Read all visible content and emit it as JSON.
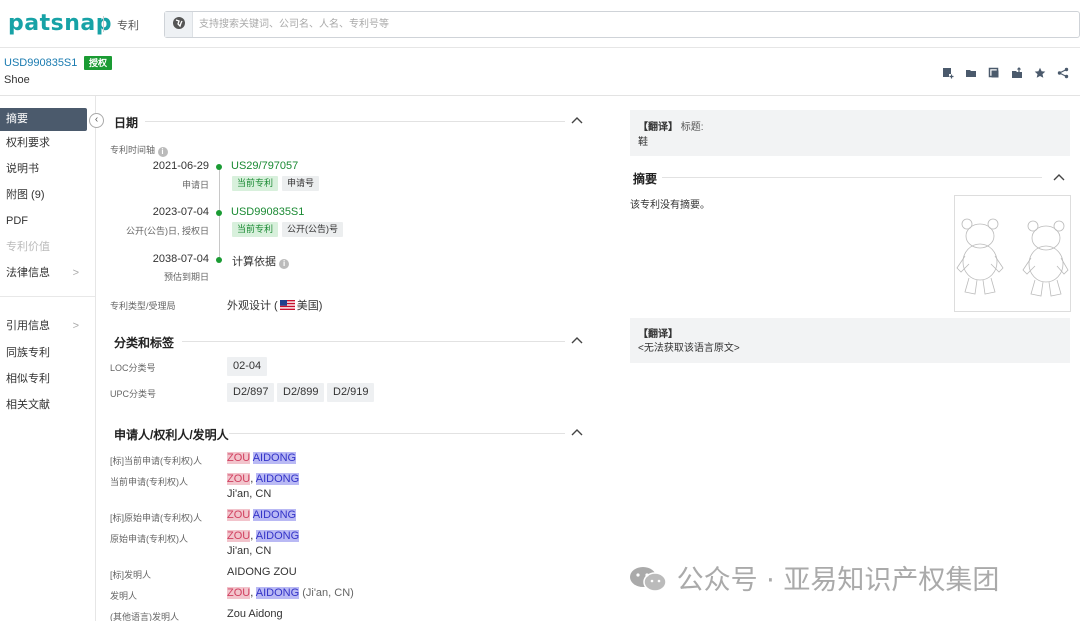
{
  "topbar": {
    "logo": "patsnap",
    "module": "专利",
    "search_placeholder": "支持搜索关键词、公司名、人名、专利号等"
  },
  "patent": {
    "number": "USD990835S1",
    "status_badge": "授权",
    "title": "Shoe"
  },
  "toolbar": [
    "add-note-icon",
    "folder-icon",
    "copy-icon",
    "export-icon",
    "star-icon",
    "share-icon"
  ],
  "sidebar": {
    "items": [
      {
        "label": "摘要"
      },
      {
        "label": "权利要求"
      },
      {
        "label": "说明书"
      },
      {
        "label": "附图 (9)"
      },
      {
        "label": "PDF"
      },
      {
        "label": "专利价值"
      },
      {
        "label": "法律信息"
      },
      {
        "label": "引用信息"
      },
      {
        "label": "同族专利"
      },
      {
        "label": "相似专利"
      },
      {
        "label": "相关文献"
      }
    ]
  },
  "dates": {
    "title": "日期",
    "timeline_label": "专利时间轴",
    "events": [
      {
        "date": "2021-06-29",
        "sub": "申请日",
        "number": "US29/797057",
        "tags": [
          "当前专利",
          "申请号"
        ]
      },
      {
        "date": "2023-07-04",
        "sub": "公开(公告)日, 授权日",
        "number": "USD990835S1",
        "tags": [
          "当前专利",
          "公开(公告)号"
        ]
      },
      {
        "date": "2038-07-04",
        "sub": "预估到期日",
        "number": "计算依据",
        "tags": []
      }
    ],
    "type_label": "专利类型/受理局",
    "type_value_pre": "外观设计 (",
    "type_value_post": "美国)"
  },
  "classification": {
    "title": "分类和标签",
    "loc_label": "LOC分类号",
    "loc_values": [
      "02-04"
    ],
    "upc_label": "UPC分类号",
    "upc_values": [
      "D2/897",
      "D2/899",
      "D2/919"
    ]
  },
  "parties": {
    "title": "申请人/权利人/发明人",
    "rows": [
      {
        "label": "[标]当前申请(专利权)人",
        "surname": "ZOU",
        "given": "AIDONG",
        "sep": " ",
        "extra": "",
        "loc": ""
      },
      {
        "label": "当前申请(专利权)人",
        "surname": "ZOU",
        "given": "AIDONG",
        "sep": ", ",
        "extra": "",
        "loc": "Ji'an, CN"
      },
      {
        "label": "[标]原始申请(专利权)人",
        "surname": "ZOU",
        "given": "AIDONG",
        "sep": " ",
        "extra": "",
        "loc": ""
      },
      {
        "label": "原始申请(专利权)人",
        "surname": "ZOU",
        "given": "AIDONG",
        "sep": ", ",
        "extra": "",
        "loc": "Ji'an, CN"
      },
      {
        "label": "[标]发明人",
        "plain": "AIDONG ZOU"
      },
      {
        "label": "发明人",
        "surname": "ZOU",
        "given": "AIDONG",
        "sep": ", ",
        "extra": " (Ji'an, CN)",
        "loc": ""
      },
      {
        "label": "(其他语言)发明人",
        "plain": "Zou Aidong"
      }
    ]
  },
  "right": {
    "translate_title_tag": "【翻译】",
    "translate_title_label": "标题:",
    "translated_title": "鞋",
    "abstract_title": "摘要",
    "abstract_text": "该专利没有摘要。",
    "translate2_tag": "【翻译】",
    "translate2_text": "<无法获取该语言原文>",
    "watermark": "公众号 · 亚易知识产权集团"
  }
}
